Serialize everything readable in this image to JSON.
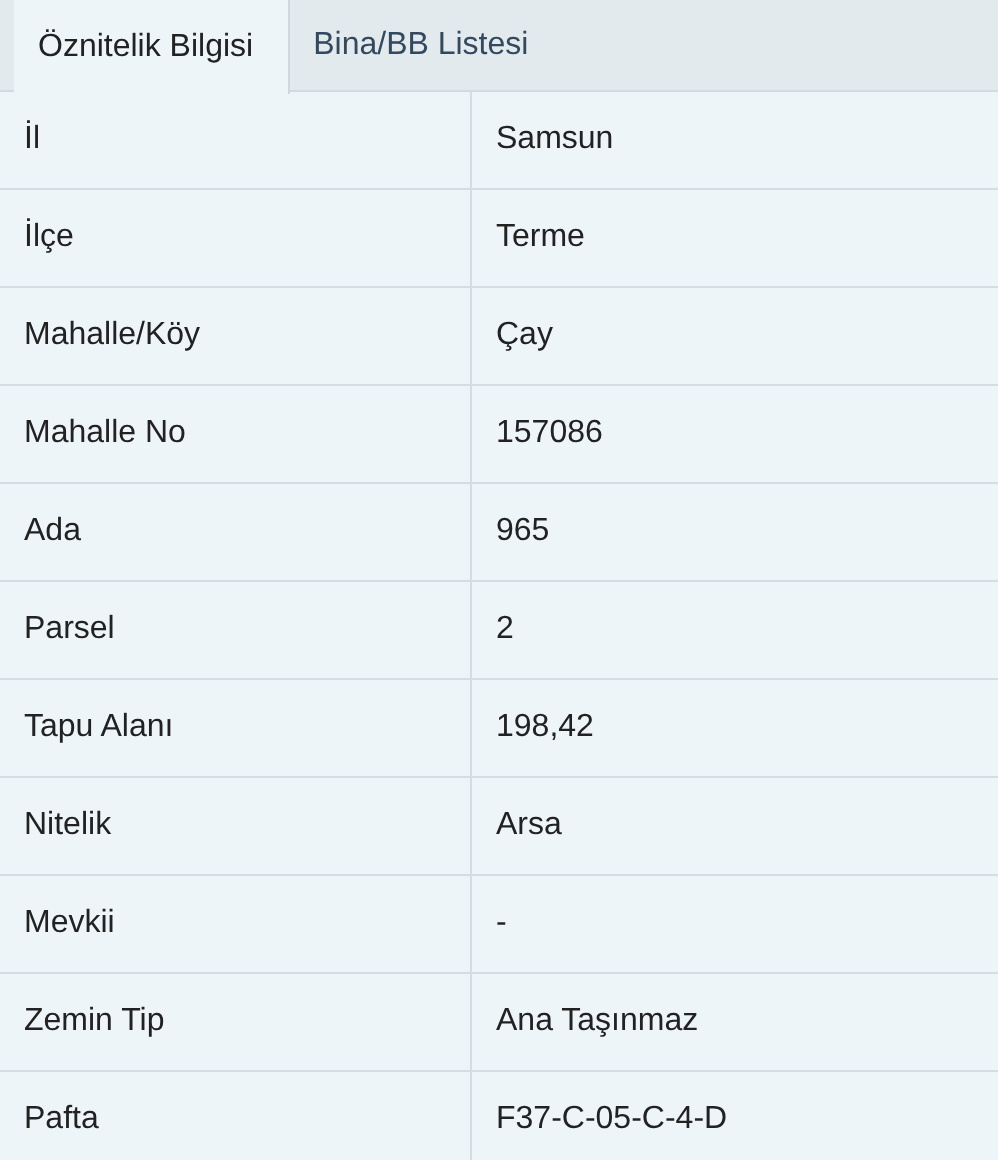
{
  "tabs": [
    {
      "label": "Öznitelik Bilgisi",
      "selected": true
    },
    {
      "label": "Bina/BB Listesi",
      "selected": false
    }
  ],
  "table": {
    "rows": [
      {
        "label": "İl",
        "value": "Samsun"
      },
      {
        "label": "İlçe",
        "value": "Terme"
      },
      {
        "label": "Mahalle/Köy",
        "value": "Çay"
      },
      {
        "label": "Mahalle No",
        "value": "157086"
      },
      {
        "label": "Ada",
        "value": "965"
      },
      {
        "label": "Parsel",
        "value": "2"
      },
      {
        "label": "Tapu Alanı",
        "value": "198,42"
      },
      {
        "label": "Nitelik",
        "value": "Arsa"
      },
      {
        "label": "Mevkii",
        "value": "-"
      },
      {
        "label": "Zemin Tip",
        "value": "Ana Taşınmaz"
      },
      {
        "label": "Pafta",
        "value": "F37-C-05-C-4-D"
      }
    ]
  }
}
